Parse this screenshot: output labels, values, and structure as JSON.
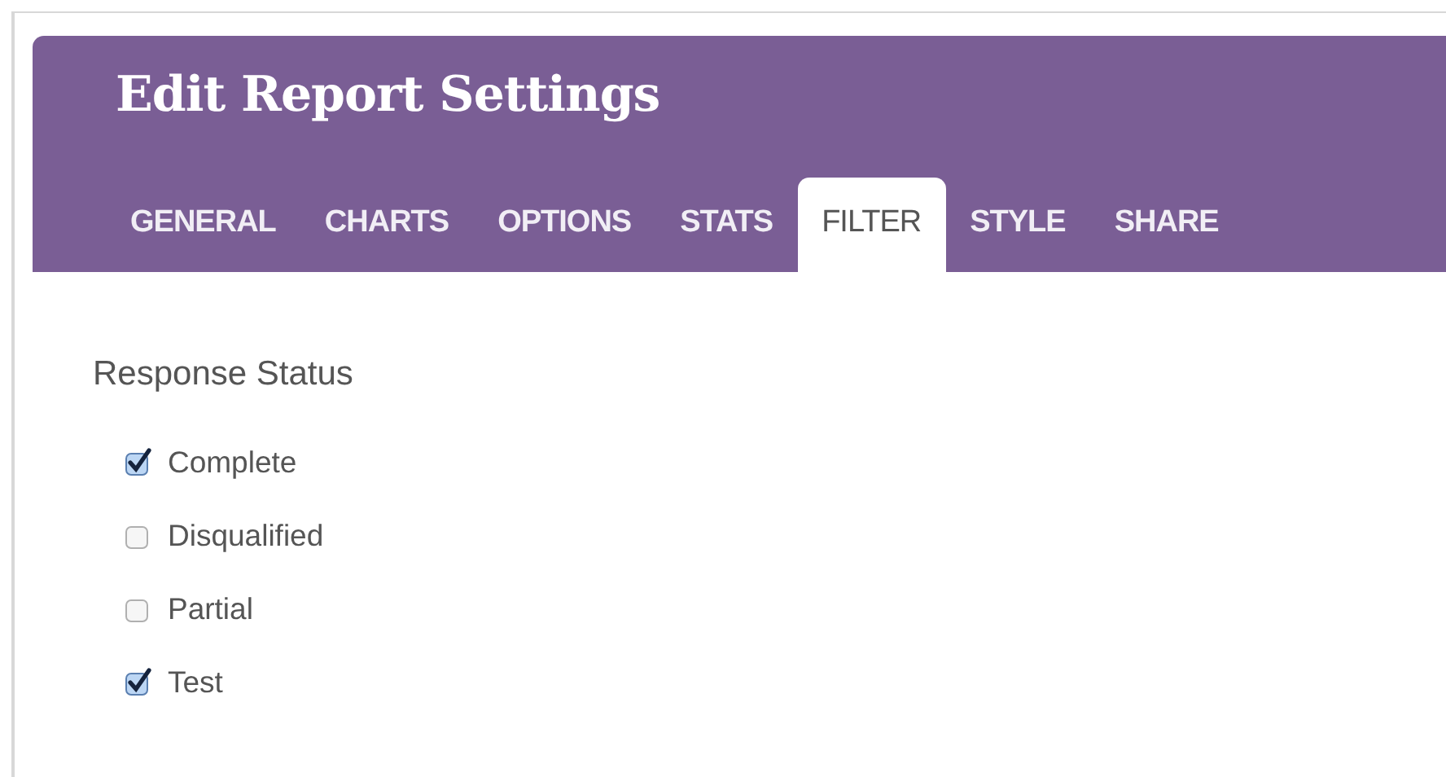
{
  "header": {
    "title": "Edit Report Settings"
  },
  "tabs": [
    {
      "label": "GENERAL",
      "selected": false
    },
    {
      "label": "CHARTS",
      "selected": false
    },
    {
      "label": "OPTIONS",
      "selected": false
    },
    {
      "label": "STATS",
      "selected": false
    },
    {
      "label": "FILTER",
      "selected": true
    },
    {
      "label": "STYLE",
      "selected": false
    },
    {
      "label": "SHARE",
      "selected": false
    }
  ],
  "section": {
    "title": "Response Status",
    "options": [
      {
        "label": "Complete",
        "checked": true
      },
      {
        "label": "Disqualified",
        "checked": false
      },
      {
        "label": "Partial",
        "checked": false
      },
      {
        "label": "Test",
        "checked": true
      }
    ]
  }
}
